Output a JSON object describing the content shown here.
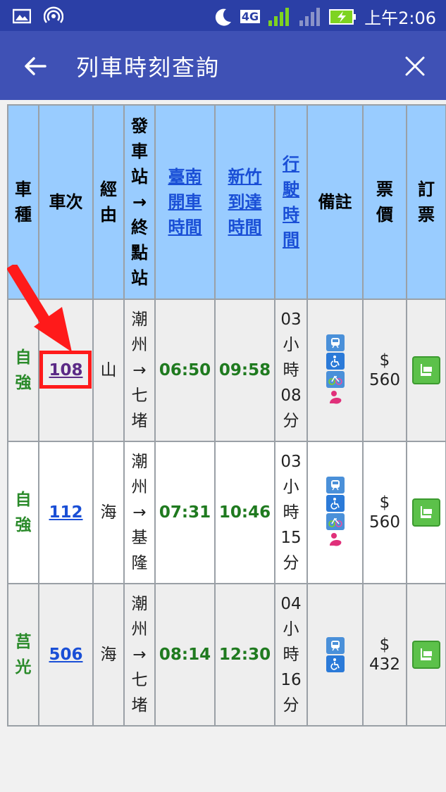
{
  "status": {
    "network": "4G",
    "time": "上午2:06"
  },
  "appbar": {
    "title": "列車時刻查詢"
  },
  "table": {
    "headers": [
      {
        "text": "車\n種",
        "link": false
      },
      {
        "text": "車次",
        "link": false
      },
      {
        "text": "經\n由",
        "link": false
      },
      {
        "text": "發\n車\n站\n→\n終\n點\n站",
        "link": false
      },
      {
        "text": "臺南\n開車\n時間",
        "link": true
      },
      {
        "text": "新竹\n到達\n時間",
        "link": true
      },
      {
        "text": "行\n駛\n時\n間",
        "link": true
      },
      {
        "text": "備註",
        "link": false
      },
      {
        "text": "票\n價",
        "link": false
      },
      {
        "text": "訂\n票",
        "link": false
      }
    ],
    "rows": [
      {
        "type": "自\n強",
        "train": "108",
        "via": "山",
        "route": "潮\n州\n→\n七\n堵",
        "dep": "06:50",
        "arr": "09:58",
        "duration": "03\n小\n時\n08\n分",
        "price": "$\n560",
        "icons": [
          "train-icon",
          "wheelchair-icon",
          "bike-icon",
          "baby-icon"
        ]
      },
      {
        "type": "自\n強",
        "train": "112",
        "via": "海",
        "route": "潮\n州\n→\n基\n隆",
        "dep": "07:31",
        "arr": "10:46",
        "duration": "03\n小\n時\n15\n分",
        "price": "$\n560",
        "icons": [
          "train-icon",
          "wheelchair-icon",
          "bike-icon",
          "baby-icon"
        ]
      },
      {
        "type": "莒\n光",
        "train": "506",
        "via": "海",
        "route": "潮\n州\n→\n七\n堵",
        "dep": "08:14",
        "arr": "12:30",
        "duration": "04\n小\n時\n16\n分",
        "price": "$\n432",
        "icons": [
          "train-icon",
          "wheelchair-icon"
        ]
      }
    ]
  },
  "colors": {
    "statusbar": "#2b3fa6",
    "appbar": "#3f51b5",
    "header": "#99ccff",
    "green": "#1f7a1f",
    "link": "#1a4fd6",
    "highlight": "#ff1a1a"
  }
}
